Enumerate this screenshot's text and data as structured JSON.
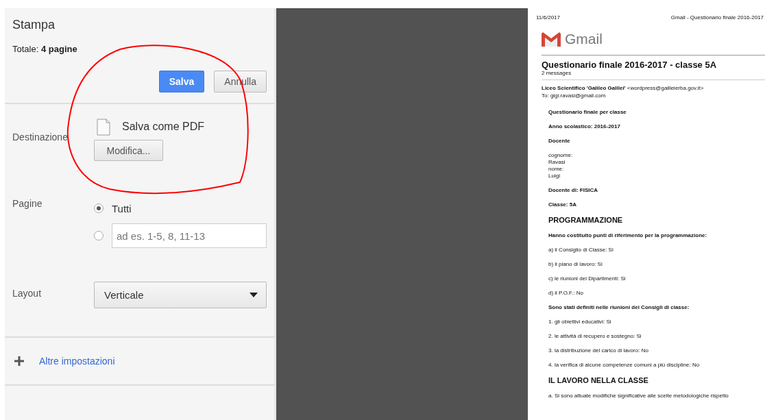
{
  "print_panel": {
    "title": "Stampa",
    "total": "Totale: **4 pagine**",
    "buttons": [
      {
        "label": "Salva",
        "kind": "primary"
      },
      {
        "label": "Annulla",
        "kind": "secondary"
      }
    ],
    "settings": [
      {
        "label": "Destinazione",
        "kind": "destination",
        "value": "Salva come PDF",
        "button": "Modifica..."
      },
      {
        "label": "Pagine",
        "kind": "pages",
        "options": [
          {
            "label": "Tutti",
            "selected": true
          },
          {
            "placeholder": "ad es. 1-5, 8, 11-13",
            "selected": false
          }
        ]
      },
      {
        "label": "Layout",
        "kind": "select",
        "value": "Verticale"
      }
    ],
    "more_settings": "Altre impostazioni"
  },
  "preview": {
    "header_date": "11/6/2017",
    "header_title": "Gmail - Questionario finale 2016-2017",
    "logo_text": "Gmail",
    "subject": "Questionario finale 2016-2017 - classe 5A",
    "message_count": "2 messages",
    "from": "**Liceo Scientifico 'Galileo Galilei'** <wordpress@galileierba.gov.it>",
    "to": "To: gigi.ravasi@gmail.com",
    "body": [
      {
        "kind": "bold",
        "text": "Questionario finale per classe"
      },
      {
        "kind": "bold",
        "text": "Anno scolastico: 2016-2017"
      },
      {
        "kind": "bold",
        "text": "Docente"
      },
      {
        "kind": "tight",
        "text": "cognome:"
      },
      {
        "kind": "tight",
        "text": "Ravasi"
      },
      {
        "kind": "tight",
        "text": "nome:"
      },
      {
        "kind": "tight",
        "text": "Luigi"
      },
      {
        "kind": "bold",
        "text": "Docente di: FISICA"
      },
      {
        "kind": "bold",
        "text": "Classe: 5A"
      },
      {
        "kind": "heading",
        "text": "PROGRAMMAZIONE"
      },
      {
        "kind": "bold",
        "text": "Hanno costituito punti di riferimento per la programmazione:"
      },
      {
        "kind": "plain",
        "text": "a) il Consiglio di Classe: Si"
      },
      {
        "kind": "plain",
        "text": "b) il piano di lavoro: Si"
      },
      {
        "kind": "plain",
        "text": "c) le riunioni dei Dipartimenti: Si"
      },
      {
        "kind": "plain",
        "text": "d) il P.O.F.: No"
      },
      {
        "kind": "bold",
        "text": "Sono stati definiti nelle riunioni dei Consigli di classe:"
      },
      {
        "kind": "plain",
        "text": "1. gli obiettivi educativi: Si"
      },
      {
        "kind": "plain",
        "text": "2. le attività di recupero e sostegno: Si"
      },
      {
        "kind": "plain",
        "text": "3. la distribuzione del carico di lavoro: No"
      },
      {
        "kind": "plain",
        "text": "4. la verifica di alcune competenze comuni a più discipline: No"
      },
      {
        "kind": "heading",
        "text": "IL LAVORO NELLA CLASSE"
      },
      {
        "kind": "plain",
        "text": "a. Si sono attuate modifiche significative alle scelte metodologiche rispetto"
      }
    ]
  }
}
